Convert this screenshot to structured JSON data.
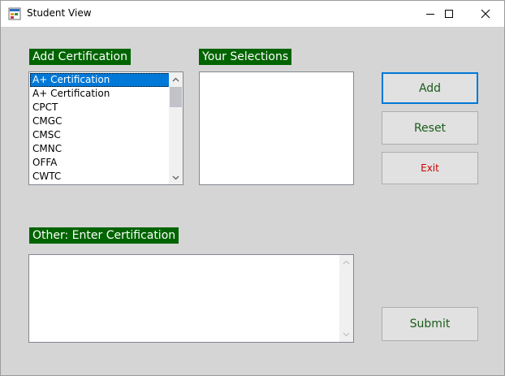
{
  "window": {
    "title": "Student View"
  },
  "labels": {
    "add_certification": "Add Certification",
    "your_selections": "Your Selections",
    "other_enter": "Other: Enter Certification"
  },
  "certifications": {
    "items": [
      "A+ Certification",
      "A+ Certification",
      "CPCT",
      "CMGC",
      "CMSC",
      "CMNC",
      "OFFA",
      "CWTC"
    ],
    "selected_index": 0
  },
  "buttons": {
    "add": "Add",
    "reset": "Reset",
    "exit": "Exit",
    "submit": "Submit"
  },
  "other_certification": {
    "value": ""
  },
  "colors": {
    "label_bg": "#006400",
    "label_text": "#ffffff",
    "button_text": "#1a5c1a",
    "exit_text": "#cc0000",
    "selection": "#0078d7",
    "window_bg": "#d5d5d5"
  }
}
